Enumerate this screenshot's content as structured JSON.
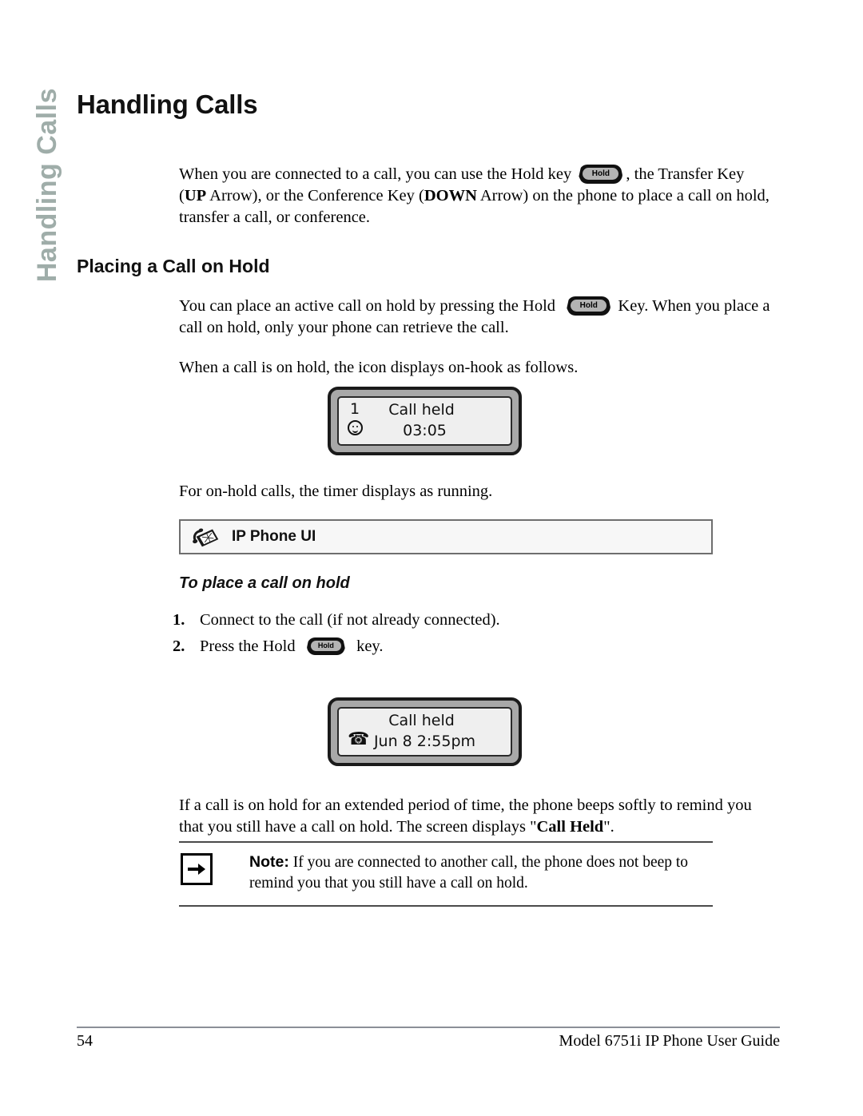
{
  "side_tab": {
    "text": "Handling Calls"
  },
  "page_title": "Handling Calls",
  "intro": {
    "text_before_key": "When you are connected to a call, you can use the Hold key",
    "hold_key_label": "Hold",
    "text_after_key": ", the Transfer Key (",
    "bold_up": "UP",
    "text_mid": " Arrow), or the Conference Key (",
    "bold_down": "DOWN",
    "text_end": " Arrow) on the phone to place a call on hold, transfer a call, or conference."
  },
  "section": {
    "heading": "Placing a Call on Hold"
  },
  "para_hold": {
    "text_before_key": "You can place an active call on hold by pressing the Hold",
    "hold_key_label": "Hold",
    "text_after_key": "Key. When you place a call on hold, only your phone can retrieve the call."
  },
  "para_icon": {
    "text": "When a call is on hold, the icon displays on-hook as follows."
  },
  "lcd_one": {
    "line_number": "1",
    "status_icon": "smiley-on-hook-icon",
    "title": "Call held",
    "timer": "03:05"
  },
  "para_timer": {
    "text": "For on-hold calls, the timer displays as running."
  },
  "ui_bar": {
    "icon": "desk-phone-icon",
    "label": "IP Phone UI"
  },
  "subhead": {
    "text": "To place a call on hold"
  },
  "steps": [
    {
      "num": "1.",
      "text": "Connect to the call (if not already connected)."
    },
    {
      "num": "2.",
      "text_before_key": "Press the Hold",
      "hold_key_label": "Hold",
      "text_after_key": "key."
    }
  ],
  "lcd_two": {
    "title": "Call held",
    "status_icon": "telephone-handset-icon",
    "timestamp": "Jun 8 2:55pm"
  },
  "para_beep": {
    "text_before_bold": "If a call is on hold for an extended period of time, the phone beeps softly to remind you that you still have a call on hold. The screen displays \"",
    "bold": "Call Held",
    "text_after_bold": "\"."
  },
  "note": {
    "icon": "right-arrow-icon",
    "label": "Note:",
    "text": " If you are connected to another call, the phone does not beep to remind you that you still have a call on hold."
  },
  "footer": {
    "page_number": "54",
    "guide_title": "Model 6751i IP Phone User Guide"
  },
  "colors": {
    "side_tab": "#9fada9",
    "heading": "#111111",
    "rule": "#8b8f97",
    "lcd_frame": "#1a1a1a",
    "lcd_bezel": "#a8a8a8",
    "lcd_screen": "#efefef",
    "hold_key_inner": "#b3b3b3"
  }
}
